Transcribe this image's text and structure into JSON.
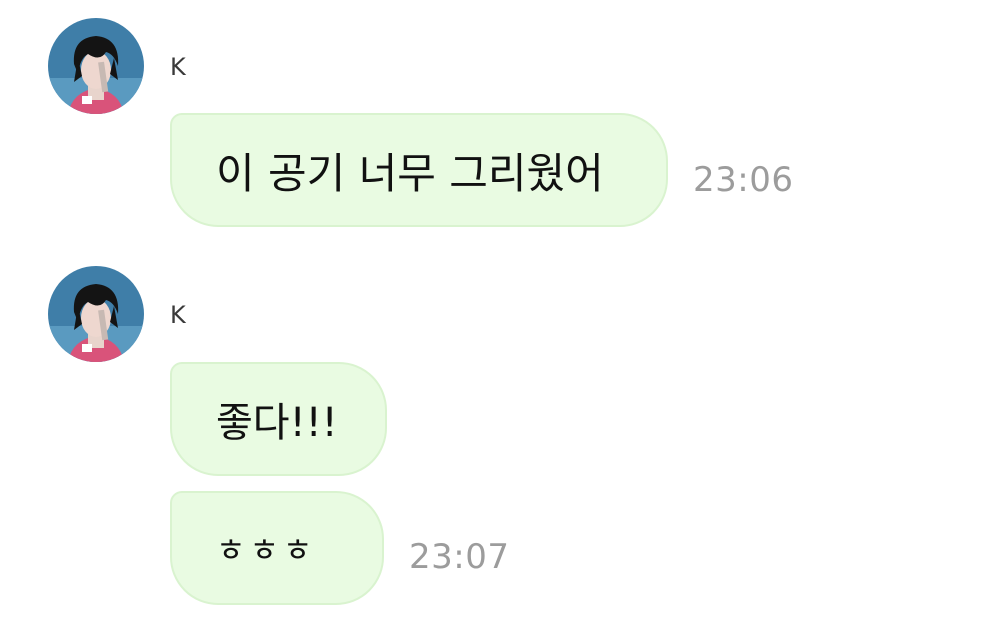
{
  "colors": {
    "bubble_bg": "#e9fbe2",
    "bubble_border": "#d9f3cf",
    "timestamp": "#9c9c9c",
    "sender_name": "#3a3a3a"
  },
  "groups": [
    {
      "sender": "K",
      "avatar_icon": "profile-photo",
      "messages": [
        {
          "text": "이 공기 너무 그리웠어",
          "time": "23:06"
        }
      ]
    },
    {
      "sender": "K",
      "avatar_icon": "profile-photo",
      "messages": [
        {
          "text": "좋다!!!",
          "time": ""
        },
        {
          "text": "ㅎㅎㅎ",
          "time": "23:07"
        }
      ]
    }
  ]
}
